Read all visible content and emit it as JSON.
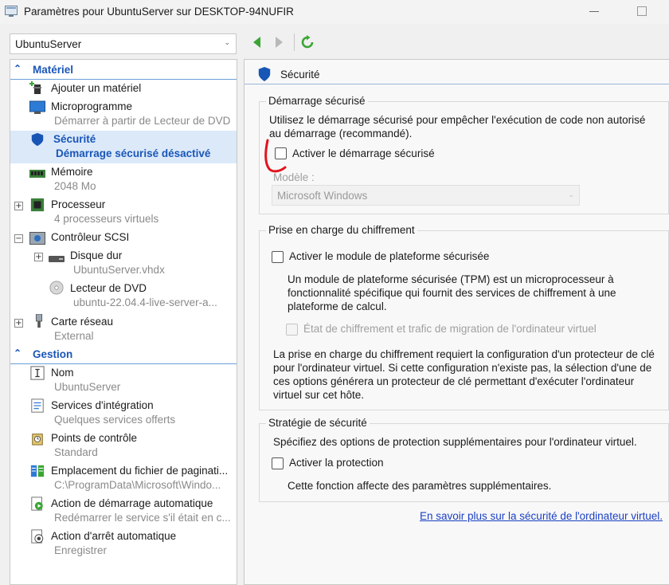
{
  "window": {
    "title": "Paramètres pour UbuntuServer sur DESKTOP-94NUFIR"
  },
  "vm_selector": {
    "value": "UbuntuServer"
  },
  "sidebar": {
    "sections": [
      {
        "label": "Matériel"
      },
      {
        "label": "Gestion"
      }
    ],
    "items": [
      {
        "label": "Ajouter un matériel",
        "sub": ""
      },
      {
        "label": "Microprogramme",
        "sub": "Démarrer à partir de Lecteur de DVD"
      },
      {
        "label": "Sécurité",
        "sub": "Démarrage sécurisé désactivé"
      },
      {
        "label": "Mémoire",
        "sub": "2048 Mo"
      },
      {
        "label": "Processeur",
        "sub": "4 processeurs virtuels"
      },
      {
        "label": "Contrôleur SCSI",
        "sub": ""
      },
      {
        "label": "Disque dur",
        "sub": "UbuntuServer.vhdx"
      },
      {
        "label": "Lecteur de DVD",
        "sub": "ubuntu-22.04.4-live-server-a..."
      },
      {
        "label": "Carte réseau",
        "sub": "External"
      },
      {
        "label": "Nom",
        "sub": "UbuntuServer"
      },
      {
        "label": "Services d'intégration",
        "sub": "Quelques services offerts"
      },
      {
        "label": "Points de contrôle",
        "sub": "Standard"
      },
      {
        "label": "Emplacement du fichier de paginati...",
        "sub": "C:\\ProgramData\\Microsoft\\Windo..."
      },
      {
        "label": "Action de démarrage automatique",
        "sub": "Redémarrer le service s'il était en c..."
      },
      {
        "label": "Action d'arrêt automatique",
        "sub": "Enregistrer"
      }
    ]
  },
  "panel": {
    "title": "Sécurité",
    "secure_boot": {
      "group_title": "Démarrage sécurisé",
      "description": "Utilisez le démarrage sécurisé pour empêcher l'exécution de code non autorisé au démarrage (recommandé).",
      "checkbox_label": "Activer le démarrage sécurisé",
      "checked": false,
      "template_label": "Modèle :",
      "template_value": "Microsoft Windows"
    },
    "encryption": {
      "group_title": "Prise en charge du chiffrement",
      "tpm_label": "Activer le module de plateforme sécurisée",
      "tpm_description": "Un module de plateforme sécurisée (TPM) est un microprocesseur à fonctionnalité spécifique qui fournit des services de chiffrement à une plateforme de calcul.",
      "encrypt_state_label": "État de chiffrement et trafic de migration de l'ordinateur virtuel",
      "note": "La prise en charge du chiffrement requiert la configuration d'un protecteur de clé pour l'ordinateur virtuel. Si cette configuration n'existe pas, la sélection d'une de ces options générera un protecteur de clé permettant d'exécuter l'ordinateur virtuel sur cet hôte."
    },
    "policy": {
      "group_title": "Stratégie de sécurité",
      "description": "Spécifiez des options de protection supplémentaires pour l'ordinateur virtuel.",
      "checkbox_label": "Activer la protection",
      "note": "Cette fonction affecte des paramètres supplémentaires."
    },
    "learn_more": "En savoir plus sur la sécurité de l'ordinateur virtuel."
  },
  "colors": {
    "accent": "#1a56b8",
    "selection": "#dbe9f9",
    "annotation": "#e0141e"
  }
}
